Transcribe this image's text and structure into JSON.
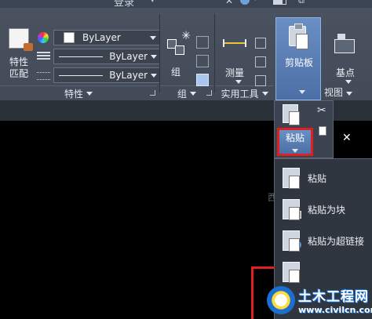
{
  "title_fragment": "登录",
  "ribbon": {
    "properties": {
      "match_label": "特性\n匹配",
      "color_value": "ByLayer",
      "linetype_value": "ByLayer",
      "lineweight_value": "ByLayer",
      "footer": "特性"
    },
    "groups": {
      "group_label": "组",
      "footer": "组"
    },
    "utilities": {
      "measure_label": "测量",
      "footer": "实用工具"
    },
    "clipboard": {
      "label": "剪贴板"
    },
    "base": {
      "label": "基点"
    },
    "view": {
      "footer": "视图"
    }
  },
  "flyout": {
    "paste_button_label": "粘贴",
    "menu": [
      {
        "label": "粘贴"
      },
      {
        "label": "粘贴为块"
      },
      {
        "label": "粘贴为超链接"
      },
      {
        "label": ""
      }
    ]
  },
  "canvas": {
    "ghost_text": "西",
    "close_glyph": "✕"
  },
  "watermark": {
    "main": "土木工程网",
    "sub": "www.civilcn.com"
  },
  "colors": {
    "ribbon_bg": "#4a5260",
    "active_blue": "#5b7fb6",
    "highlight_red": "#e02020",
    "canvas_bg": "#000000"
  }
}
